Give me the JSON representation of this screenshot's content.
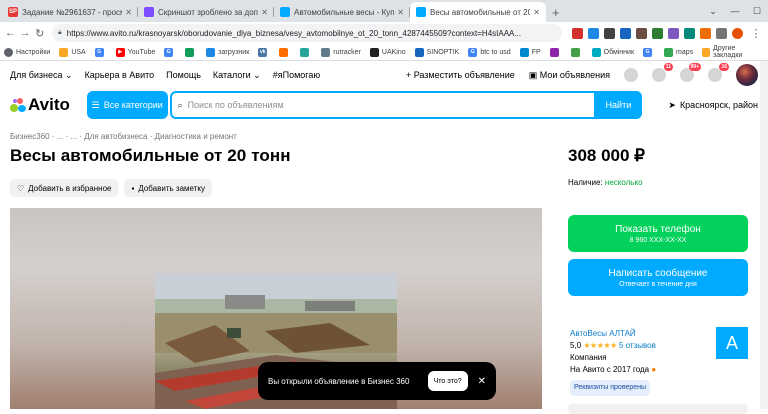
{
  "browser": {
    "tabs": [
      {
        "label": "Задание №2961637 - просмотр з",
        "color": "#e53935",
        "icon": "SP"
      },
      {
        "label": "Скриншот зроблено за допомогою",
        "color": "#7c4dff",
        "icon": ""
      },
      {
        "label": "Автомобильные весы - Купить о",
        "color": "#00aaff",
        "icon": ""
      },
      {
        "label": "Весы автомобильные от 20 тонн",
        "color": "#00aaff",
        "icon": ""
      }
    ],
    "new_tab": "+",
    "url": "https://www.avito.ru/krasnoyarsk/oborudovanie_dlya_biznesa/vesy_avtomobilnye_ot_20_tonn_4287445509?context=H4sIAAA...",
    "bookmarks": [
      "Настройки",
      "USA",
      "",
      "YouTube",
      "",
      "",
      "загрузник",
      "",
      "",
      "",
      "rutracker",
      "UAKino",
      "SINOPTIK",
      "btc to usd",
      "FP",
      "",
      "",
      "Обмінник",
      "",
      "maps"
    ],
    "other_bookmarks": "Другие закладки"
  },
  "header": {
    "links": [
      "Для бизнеса",
      "Карьера в Авито",
      "Помощь",
      "Каталоги",
      "#яПомогаю"
    ],
    "post_ad": "Разместить объявление",
    "my_ads": "Мои объявления",
    "badges": {
      "fav": "",
      "msg": "11",
      "notif": "99+",
      "cart": "16"
    }
  },
  "search": {
    "logo": "Avito",
    "categories": "Все категории",
    "placeholder": "Поиск по объявлениям",
    "button": "Найти",
    "location": "Красноярск, район"
  },
  "listing": {
    "breadcrumbs": [
      "Бизнес360",
      "...",
      "...",
      "Для автобизнеса",
      "Диагностика и ремонт"
    ],
    "title": "Весы автомобильные от 20 тонн",
    "price": "308 000 ₽",
    "add_fav": "Добавить в избранное",
    "add_note": "Добавить заметку",
    "availability_label": "Наличие:",
    "availability_value": "несколько"
  },
  "contact": {
    "show_phone": "Показать телефон",
    "phone_masked": "8 960 XXX-XX-XX",
    "write": "Написать сообщение",
    "reply_time": "Отвечает в течение дня"
  },
  "seller": {
    "name": "АвтоВесы АЛТАЙ",
    "rating": "5,0",
    "stars": "★★★★★",
    "reviews": "5 отзывов",
    "type": "Компания",
    "since": "На Авито с 2017 года",
    "verified": "Реквизиты проверены",
    "avatar_letter": "А"
  },
  "toast": {
    "text": "Вы открыли объявление в Бизнес 360",
    "button": "Что это?"
  },
  "colors": {
    "accent": "#00aaff",
    "green": "#02d15c",
    "danger": "#ff4053"
  }
}
